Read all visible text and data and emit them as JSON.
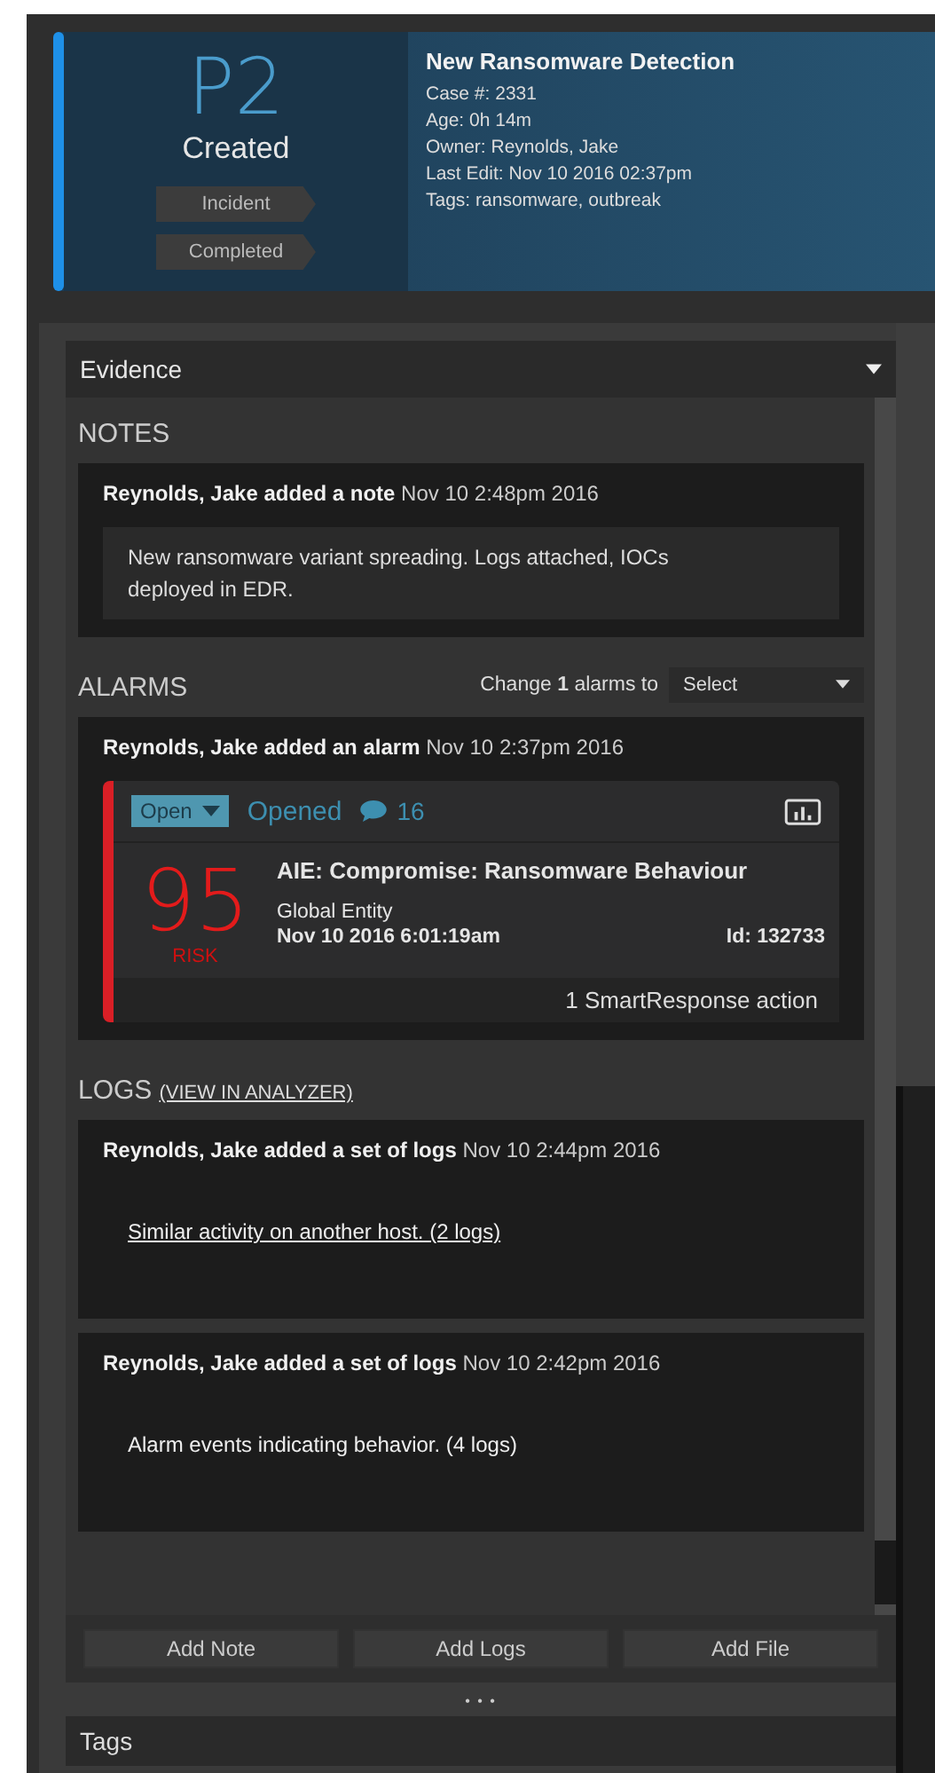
{
  "case": {
    "priority": "P2",
    "status": "Created",
    "stages": [
      "Incident",
      "Completed"
    ],
    "title": "New Ransomware Detection",
    "details": [
      "Case #: 2331",
      "Age: 0h 14m",
      "Owner: Reynolds, Jake",
      "Last Edit: Nov 10 2016 02:37pm",
      "Tags: ransomware, outbreak"
    ]
  },
  "evidence": {
    "title": "Evidence",
    "notes": {
      "heading": "NOTES",
      "items": [
        {
          "header": "**Reynolds, Jake added a note** Nov 10 2:48pm 2016",
          "body": "New ransomware variant spreading. Logs attached, IOCs deployed in EDR."
        }
      ]
    },
    "alarms": {
      "heading": "ALARMS",
      "change_label": "Change **1** alarms to",
      "select": "Select",
      "items": [
        {
          "header": "**Reynolds, Jake added an alarm** Nov 10 2:37pm 2016",
          "status": "Open",
          "state": "Opened",
          "comments": "16",
          "risk": "95",
          "risk_label": "RISK",
          "name": "AIE: Compromise: Ransomware Behaviour",
          "entity": "Global Entity",
          "date": "Nov 10 2016 6:01:19am",
          "id": "Id: 132733",
          "actions": "1 SmartResponse action"
        }
      ]
    },
    "logs": {
      "heading": "LOGS",
      "link": "(VIEW IN ANALYZER)",
      "items": [
        {
          "header": "**Reynolds, Jake added a set of logs** Nov 10 2:44pm 2016",
          "body": "Similar activity on another host. (2 logs)",
          "linked": true
        },
        {
          "header": "**Reynolds, Jake added a set of logs** Nov 10 2:42pm 2016",
          "body": "Alarm events indicating behavior. (4 logs)",
          "linked": false
        }
      ]
    },
    "buttons": [
      "Add Note",
      "Add Logs",
      "Add File"
    ],
    "more": "• • •"
  },
  "tags": {
    "title": "Tags"
  }
}
